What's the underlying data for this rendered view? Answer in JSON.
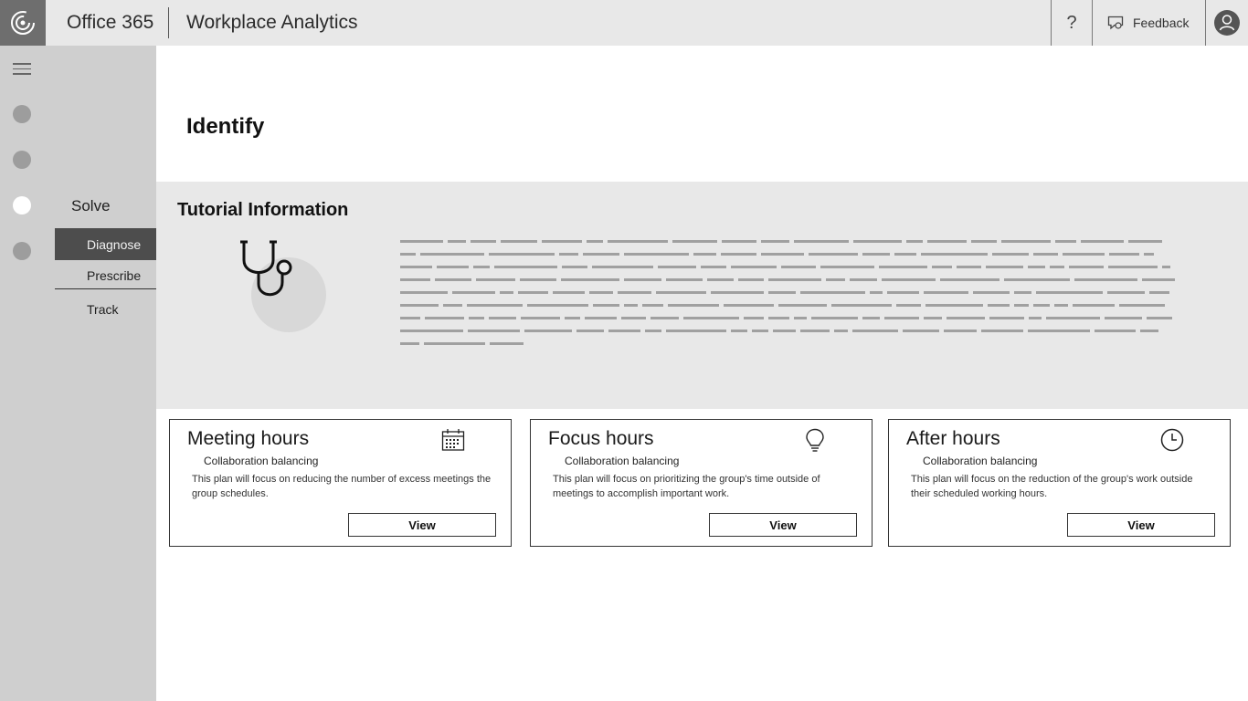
{
  "header": {
    "app_name": "Office 365",
    "product_name": "Workplace Analytics",
    "help_label": "?",
    "feedback_label": "Feedback"
  },
  "subnav": {
    "title": "Solve",
    "items": [
      {
        "label": "Diagnose",
        "selected": true
      },
      {
        "label": "Prescribe",
        "selected": false
      },
      {
        "label": "Track",
        "selected": false
      }
    ]
  },
  "page": {
    "heading": "Identify"
  },
  "tutorial": {
    "title": "Tutorial Information",
    "illustration_icon": "stethoscope-icon"
  },
  "cards": [
    {
      "title": "Meeting hours",
      "icon": "calendar-icon",
      "subtitle": "Collaboration balancing",
      "description": "This plan will focus on reducing the number of excess meetings the group schedules.",
      "button": "View"
    },
    {
      "title": "Focus hours",
      "icon": "lightbulb-icon",
      "subtitle": "Collaboration balancing",
      "description": "This plan will focus on prioritizing the group's time outside of meetings to accomplish important work.",
      "button": "View"
    },
    {
      "title": "After hours",
      "icon": "clock-icon",
      "subtitle": "Collaboration balancing",
      "description": "This plan will focus on the reduction of the group's work outside their scheduled working hours.",
      "button": "View"
    }
  ],
  "colors": {
    "topbar": "#e8e8e8",
    "rail": "#cfcfcf",
    "selected_nav": "#4d4d4d",
    "tutorial_bg": "#e8e8e8"
  }
}
